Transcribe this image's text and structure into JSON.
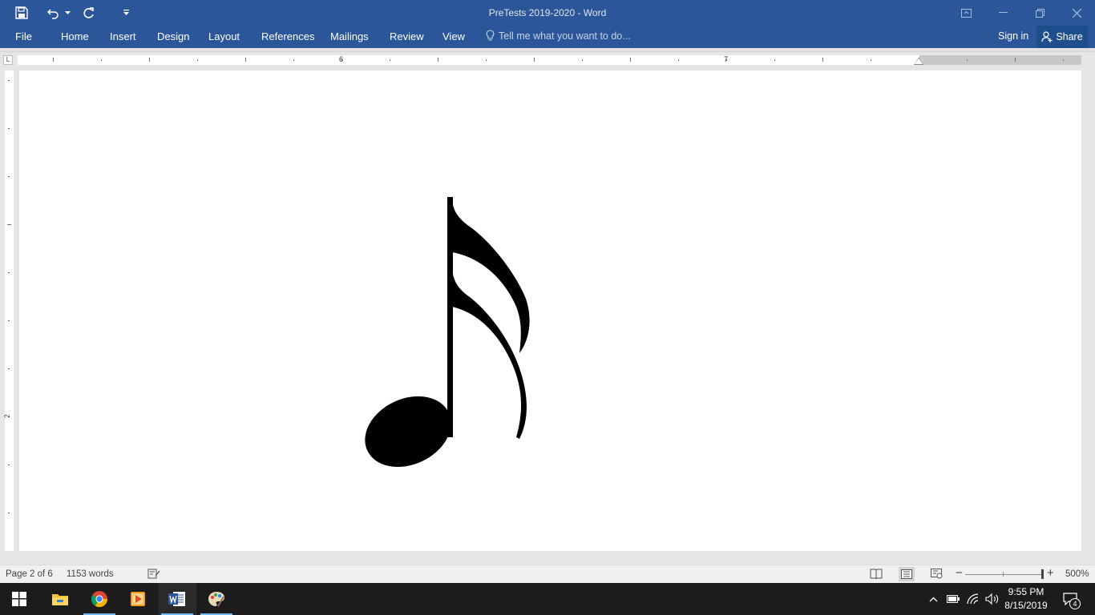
{
  "window": {
    "title": "PreTests 2019-2020 - Word"
  },
  "ribbon": {
    "file_label": "File",
    "tabs": [
      {
        "label": "Home"
      },
      {
        "label": "Insert"
      },
      {
        "label": "Design"
      },
      {
        "label": "Layout"
      },
      {
        "label": "References"
      },
      {
        "label": "Mailings"
      },
      {
        "label": "Review"
      },
      {
        "label": "View"
      }
    ],
    "tell_me_placeholder": "Tell me what you want to do...",
    "sign_in_label": "Sign in",
    "share_label": "Share"
  },
  "ruler": {
    "horizontal_numbers": [
      "6",
      "7"
    ],
    "vertical_numbers": [
      "2"
    ],
    "corner_glyph": "L"
  },
  "document": {
    "content_icon": "eighth-note-double-flag-icon"
  },
  "status_bar": {
    "page_info": "Page 2 of 6",
    "word_count": "1153 words",
    "zoom_level": "500%",
    "zoom_fraction": 1.0
  },
  "taskbar": {
    "time": "9:55 PM",
    "date": "8/15/2019",
    "notification_count": "4",
    "apps": [
      "start-icon",
      "file-explorer-icon",
      "chrome-icon",
      "media-player-icon",
      "word-icon",
      "paint-icon"
    ]
  },
  "colors": {
    "word_blue": "#2b579a",
    "taskbar": "#1c1c1c"
  }
}
